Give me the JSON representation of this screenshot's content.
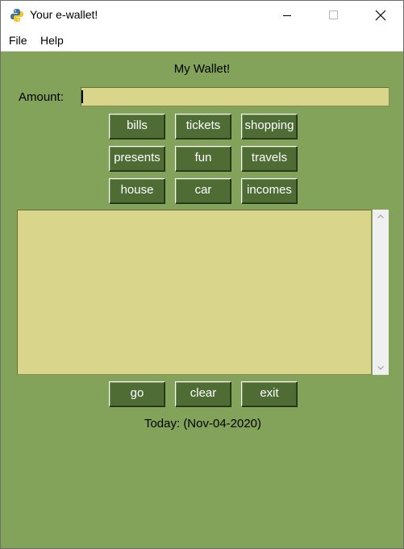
{
  "window": {
    "title": "Your e-wallet!",
    "accent_bg": "#83a25a",
    "button_bg": "#4f6c35",
    "field_bg": "#d9d58a"
  },
  "menu": {
    "file": "File",
    "help": "Help"
  },
  "main": {
    "heading": "My Wallet!",
    "amount_label": "Amount:",
    "amount_value": "",
    "categories": {
      "bills": "bills",
      "tickets": "tickets",
      "shopping": "shopping",
      "presents": "presents",
      "fun": "fun",
      "travels": "travels",
      "house": "house",
      "car": "car",
      "incomes": "incomes"
    },
    "log_text": "",
    "actions": {
      "go": "go",
      "clear": "clear",
      "exit": "exit"
    },
    "today": "Today: (Nov-04-2020)"
  }
}
